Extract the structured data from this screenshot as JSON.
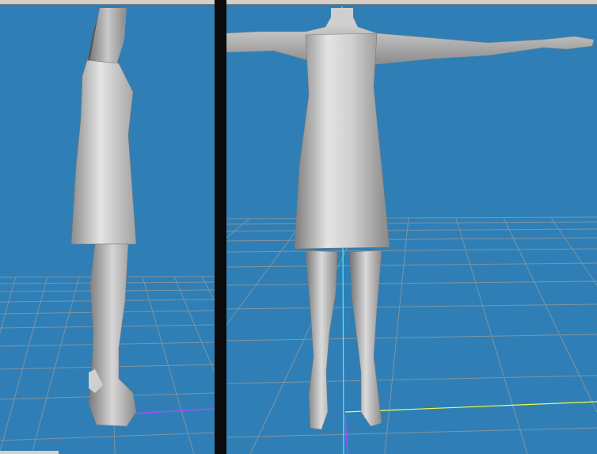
{
  "app": {
    "theme": {
      "viewport_bg": "#2f7fb6",
      "grid_line": "#9a9a9a",
      "axis_y": "#f2ff4a",
      "axis_x": "#a050ff",
      "axis_z": "#43f2ff",
      "model_light": "#e7e7e7",
      "model_mid": "#bdbdbd",
      "model_dark": "#7e7e7e"
    }
  },
  "viewports": [
    {
      "name": "side-view",
      "view": "side"
    },
    {
      "name": "front-view",
      "view": "front"
    }
  ]
}
